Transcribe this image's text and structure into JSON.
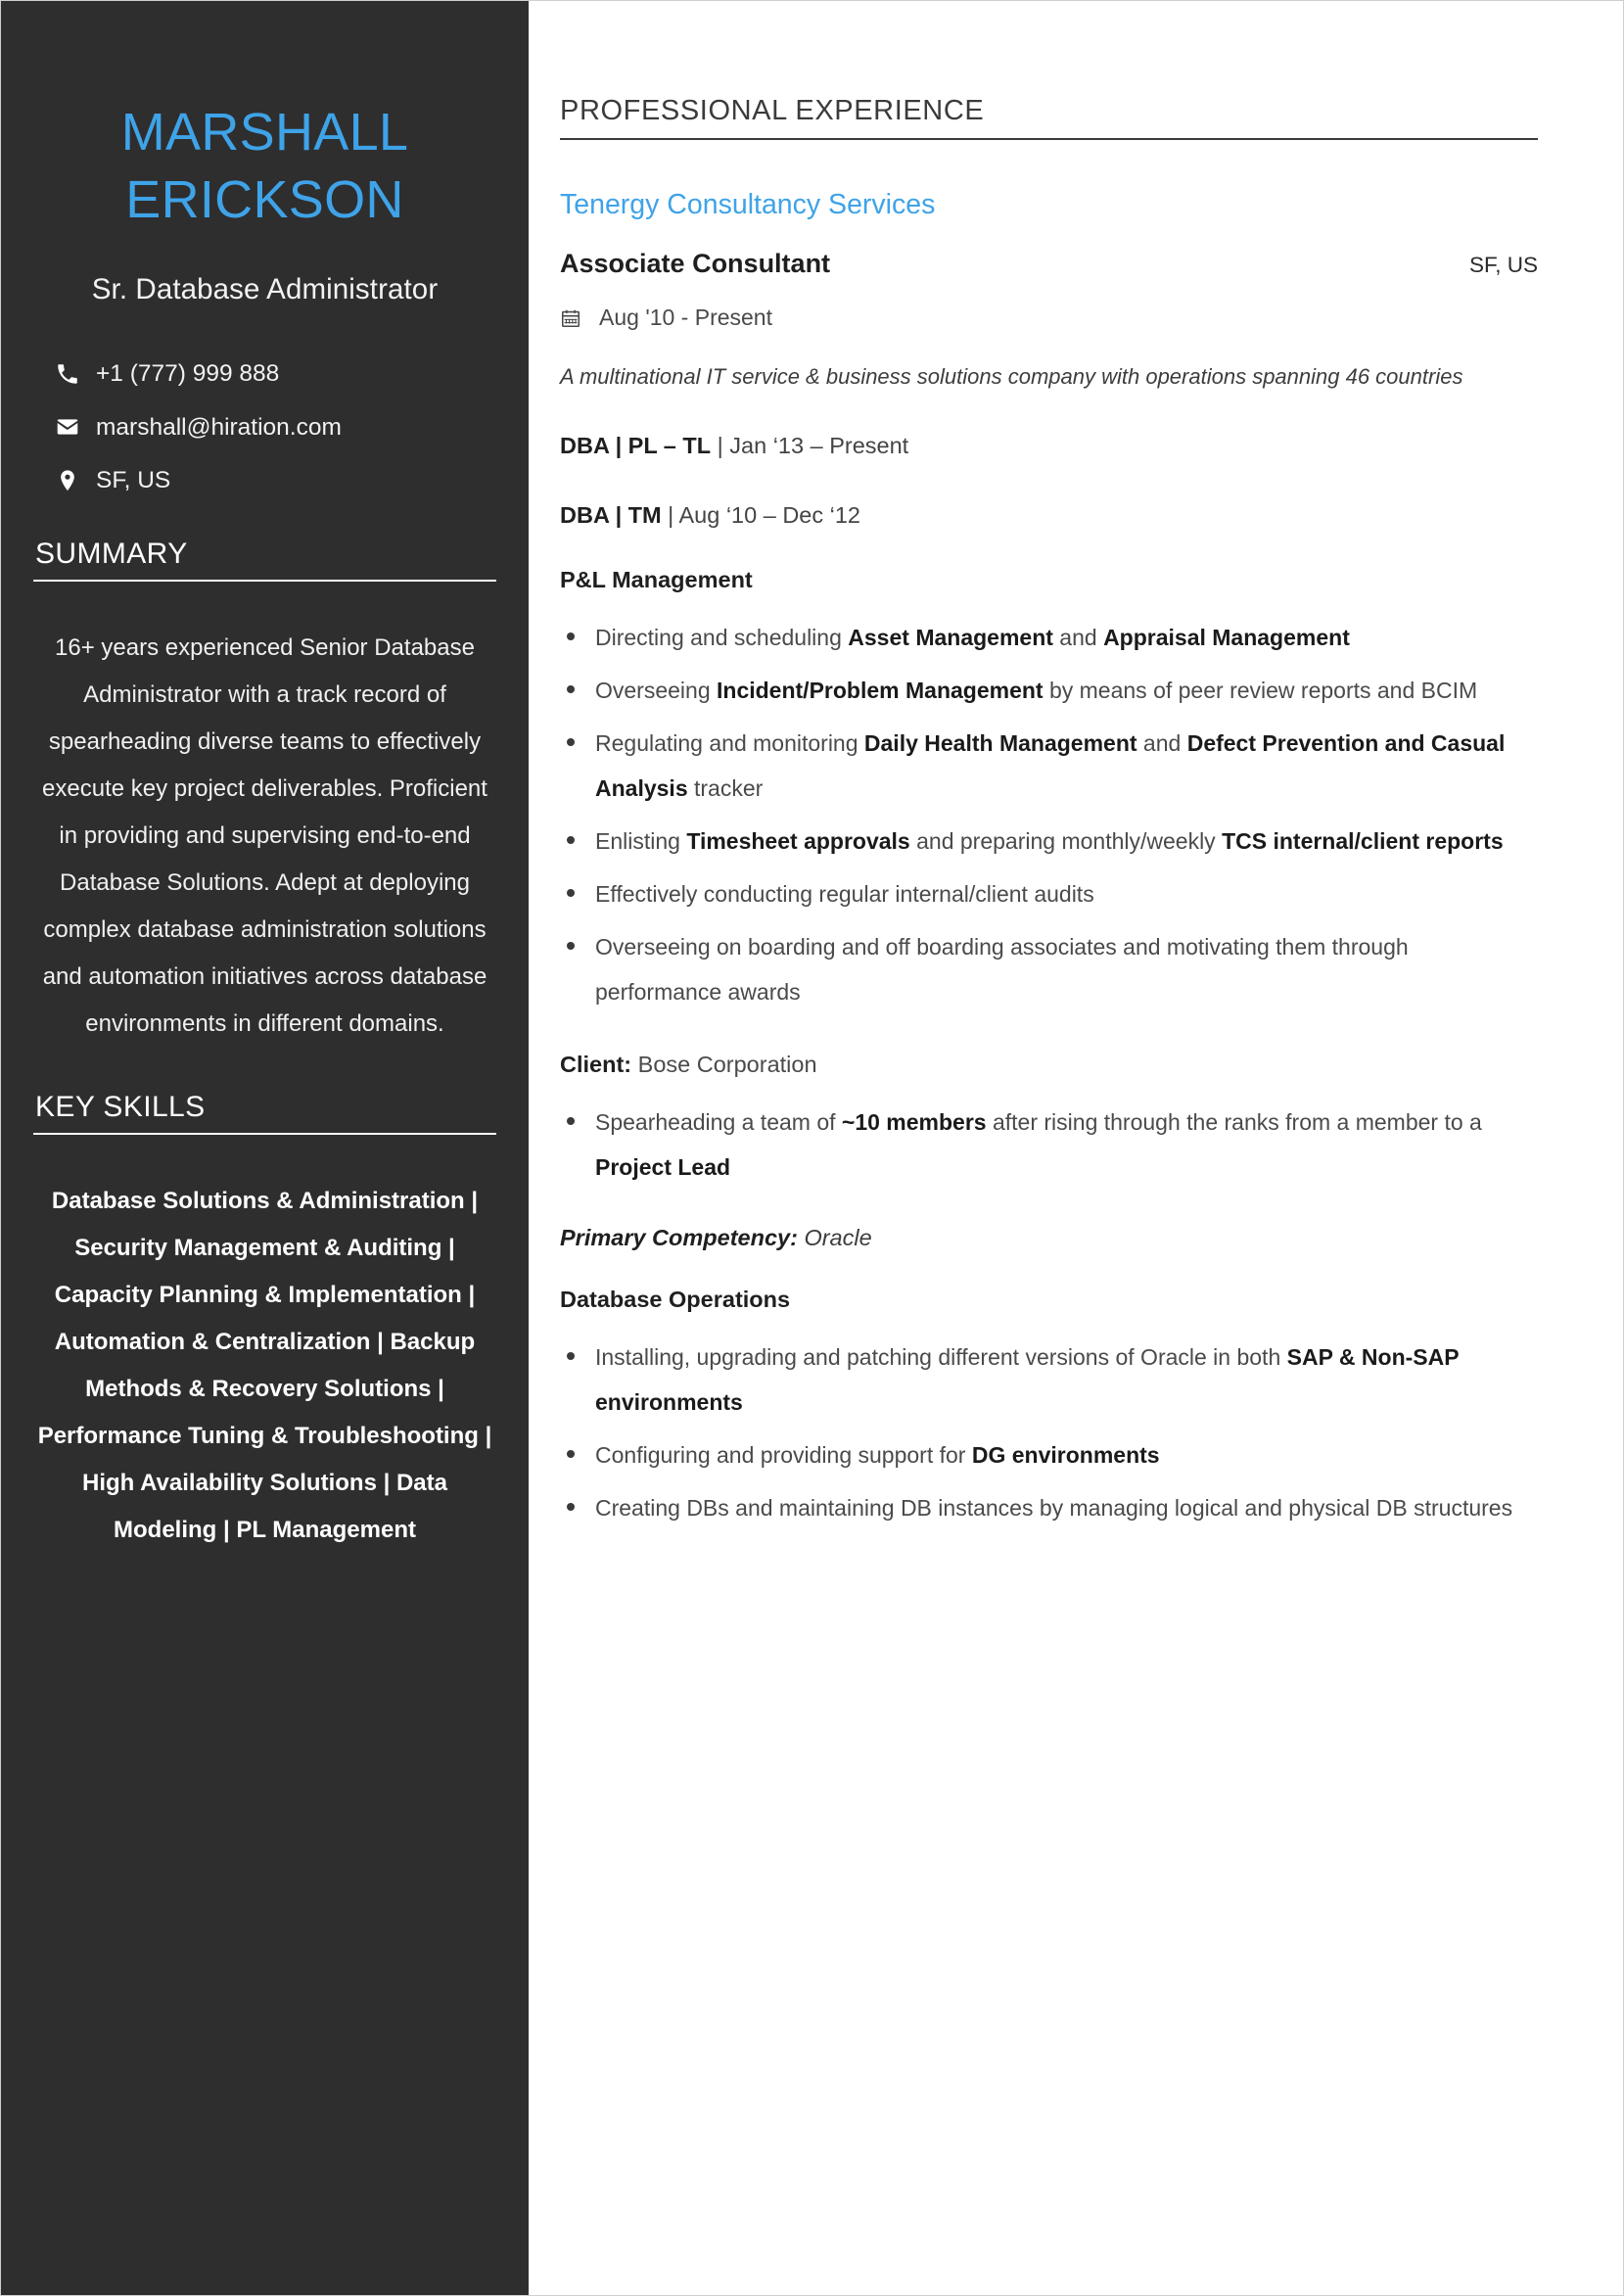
{
  "theme": {
    "sidebar_bg": "#2e2e2e",
    "accent": "#3fa3e8",
    "page_bg": "#ffffff",
    "text_dark": "#2b2b2b"
  },
  "sidebar": {
    "name_line1": "MARSHALL",
    "name_line2": "ERICKSON",
    "job_title": "Sr. Database Administrator",
    "contacts": [
      {
        "icon": "phone-icon",
        "value": "+1 (777) 999 888"
      },
      {
        "icon": "envelope-icon",
        "value": "marshall@hiration.com"
      },
      {
        "icon": "map-pin-icon",
        "value": "SF, US"
      }
    ],
    "summary": {
      "heading": "SUMMARY",
      "text": "16+ years experienced Senior Database Administrator with a track record of spearheading diverse teams to effectively execute key project deliverables. Proficient in providing and supervising end-to-end Database Solutions. Adept at deploying complex database administration solutions and automation initiatives across database environments in different domains."
    },
    "key_skills": {
      "heading": "KEY SKILLS",
      "text": "Database Solutions & Administration | Security Management & Auditing | Capacity Planning & Implementation | Automation & Centralization | Backup Methods & Recovery Solutions | Performance Tuning & Troubleshooting | High Availability Solutions | Data Modeling | PL Management"
    }
  },
  "main": {
    "section_heading": "PROFESSIONAL EXPERIENCE",
    "experience": {
      "company": "Tenergy Consultancy Services",
      "role_title": "Associate Consultant",
      "location": "SF, US",
      "dates": "Aug '10  -  Present",
      "company_description": "A multinational IT service & business solutions company with operations spanning 46 countries",
      "role_periods": [
        {
          "role": "DBA | PL – TL",
          "separator": " | ",
          "dates": "Jan ‘13 – Present"
        },
        {
          "role": "DBA | TM",
          "separator": " | ",
          "dates": "Aug ‘10 – Dec ‘12"
        }
      ],
      "groups": [
        {
          "heading": "P&L Management",
          "bullets": [
            [
              {
                "t": "Directing and scheduling ",
                "b": false
              },
              {
                "t": "Asset Management",
                "b": true
              },
              {
                "t": " and ",
                "b": false
              },
              {
                "t": "Appraisal Management",
                "b": true
              }
            ],
            [
              {
                "t": "Overseeing ",
                "b": false
              },
              {
                "t": "Incident/Problem Management",
                "b": true
              },
              {
                "t": " by means of peer review reports and BCIM",
                "b": false
              }
            ],
            [
              {
                "t": "Regulating and monitoring ",
                "b": false
              },
              {
                "t": "Daily Health Management",
                "b": true
              },
              {
                "t": " and ",
                "b": false
              },
              {
                "t": "Defect Prevention and Casual Analysis",
                "b": true
              },
              {
                "t": " tracker",
                "b": false
              }
            ],
            [
              {
                "t": "Enlisting ",
                "b": false
              },
              {
                "t": "Timesheet approvals",
                "b": true
              },
              {
                "t": " and preparing monthly/weekly ",
                "b": false
              },
              {
                "t": "TCS internal/client reports",
                "b": true
              }
            ],
            [
              {
                "t": "Effectively conducting regular internal/client audits",
                "b": false
              }
            ],
            [
              {
                "t": "Overseeing on boarding and off boarding associates and motivating them through performance awards",
                "b": false
              }
            ]
          ]
        }
      ],
      "client_label": "Client:",
      "client_name": "Bose Corporation",
      "client_bullets": [
        [
          {
            "t": "Spearheading a team of ",
            "b": false
          },
          {
            "t": "~10 members",
            "b": true
          },
          {
            "t": " after rising through the ranks from a member to a ",
            "b": false
          },
          {
            "t": "Project Lead",
            "b": true
          }
        ]
      ],
      "competency_label": "Primary Competency:",
      "competency_value": "Oracle",
      "operations": {
        "heading": "Database Operations",
        "bullets": [
          [
            {
              "t": "Installing, upgrading and patching different versions of Oracle in both ",
              "b": false
            },
            {
              "t": "SAP & Non-SAP environments",
              "b": true
            }
          ],
          [
            {
              "t": "Configuring and providing support for ",
              "b": false
            },
            {
              "t": "DG environments",
              "b": true
            }
          ],
          [
            {
              "t": "Creating DBs and maintaining DB instances by managing logical and physical DB structures",
              "b": false
            }
          ]
        ]
      }
    }
  }
}
